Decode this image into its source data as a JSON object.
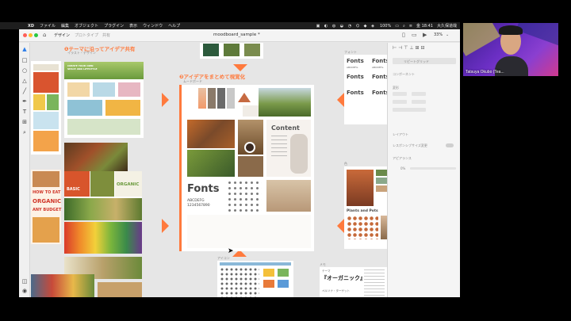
{
  "menubar": {
    "app": "XD",
    "items": [
      "ファイル",
      "編集",
      "オブジェクト",
      "プラグイン",
      "表示",
      "ウィンドウ",
      "ヘルプ"
    ],
    "battery": "100%",
    "time": "金 18:41",
    "user": "大久保道哉"
  },
  "app": {
    "tabs": [
      "デザイン",
      "プロトタイプ",
      "共有"
    ],
    "doc_title": "moodboard_sample *",
    "zoom": "33%"
  },
  "canvas": {
    "label_left": "イラスト・デザイン",
    "heading_1": "❶テーマに沿ってアイデア共有",
    "label_center": "ムードボード",
    "heading_2": "❷アイデアをまとめて視覚化",
    "label_fonts": "フォント",
    "label_color": "色",
    "label_icons": "アイコン",
    "label_memo": "メモ",
    "moodboard": {
      "fonts_title": "Fonts",
      "fonts_sample": "ABCDEFG",
      "fonts_digits": "1234567890",
      "content_title": "Content"
    },
    "left_images": {
      "how_to": "HOW TO EAT",
      "organic": "ORGANIC",
      "budget": "ANY BUDGET",
      "basic": "BASIC",
      "organic_word": "ORGANIC",
      "slogan": "CREATE YOUR OWN SPACE AND LIFESTYLE"
    },
    "fonts_board": {
      "label": "Fonts",
      "sub": "ABCDEFG"
    },
    "color_board": {
      "title": "Plants and Pots"
    },
    "memo": {
      "theme_label": "テーマ",
      "theme": "『オーガニック』",
      "sub": "ペルソナ・ターゲット"
    }
  },
  "panel": {
    "repeat_grid": "リピートグリッド",
    "component": "コンポーネント",
    "transform": "変形",
    "layout": "レイアウト",
    "responsive": "レスポンシブサイズ変更",
    "appearance": "アピアランス",
    "opacity": "0%"
  },
  "webcam": {
    "name": "Tatsuya Okubo (Tea..."
  },
  "colors": {
    "accent": "#ff7a3d",
    "app_bg": "#e8e8e8",
    "menubar": "#1e1e1e"
  }
}
